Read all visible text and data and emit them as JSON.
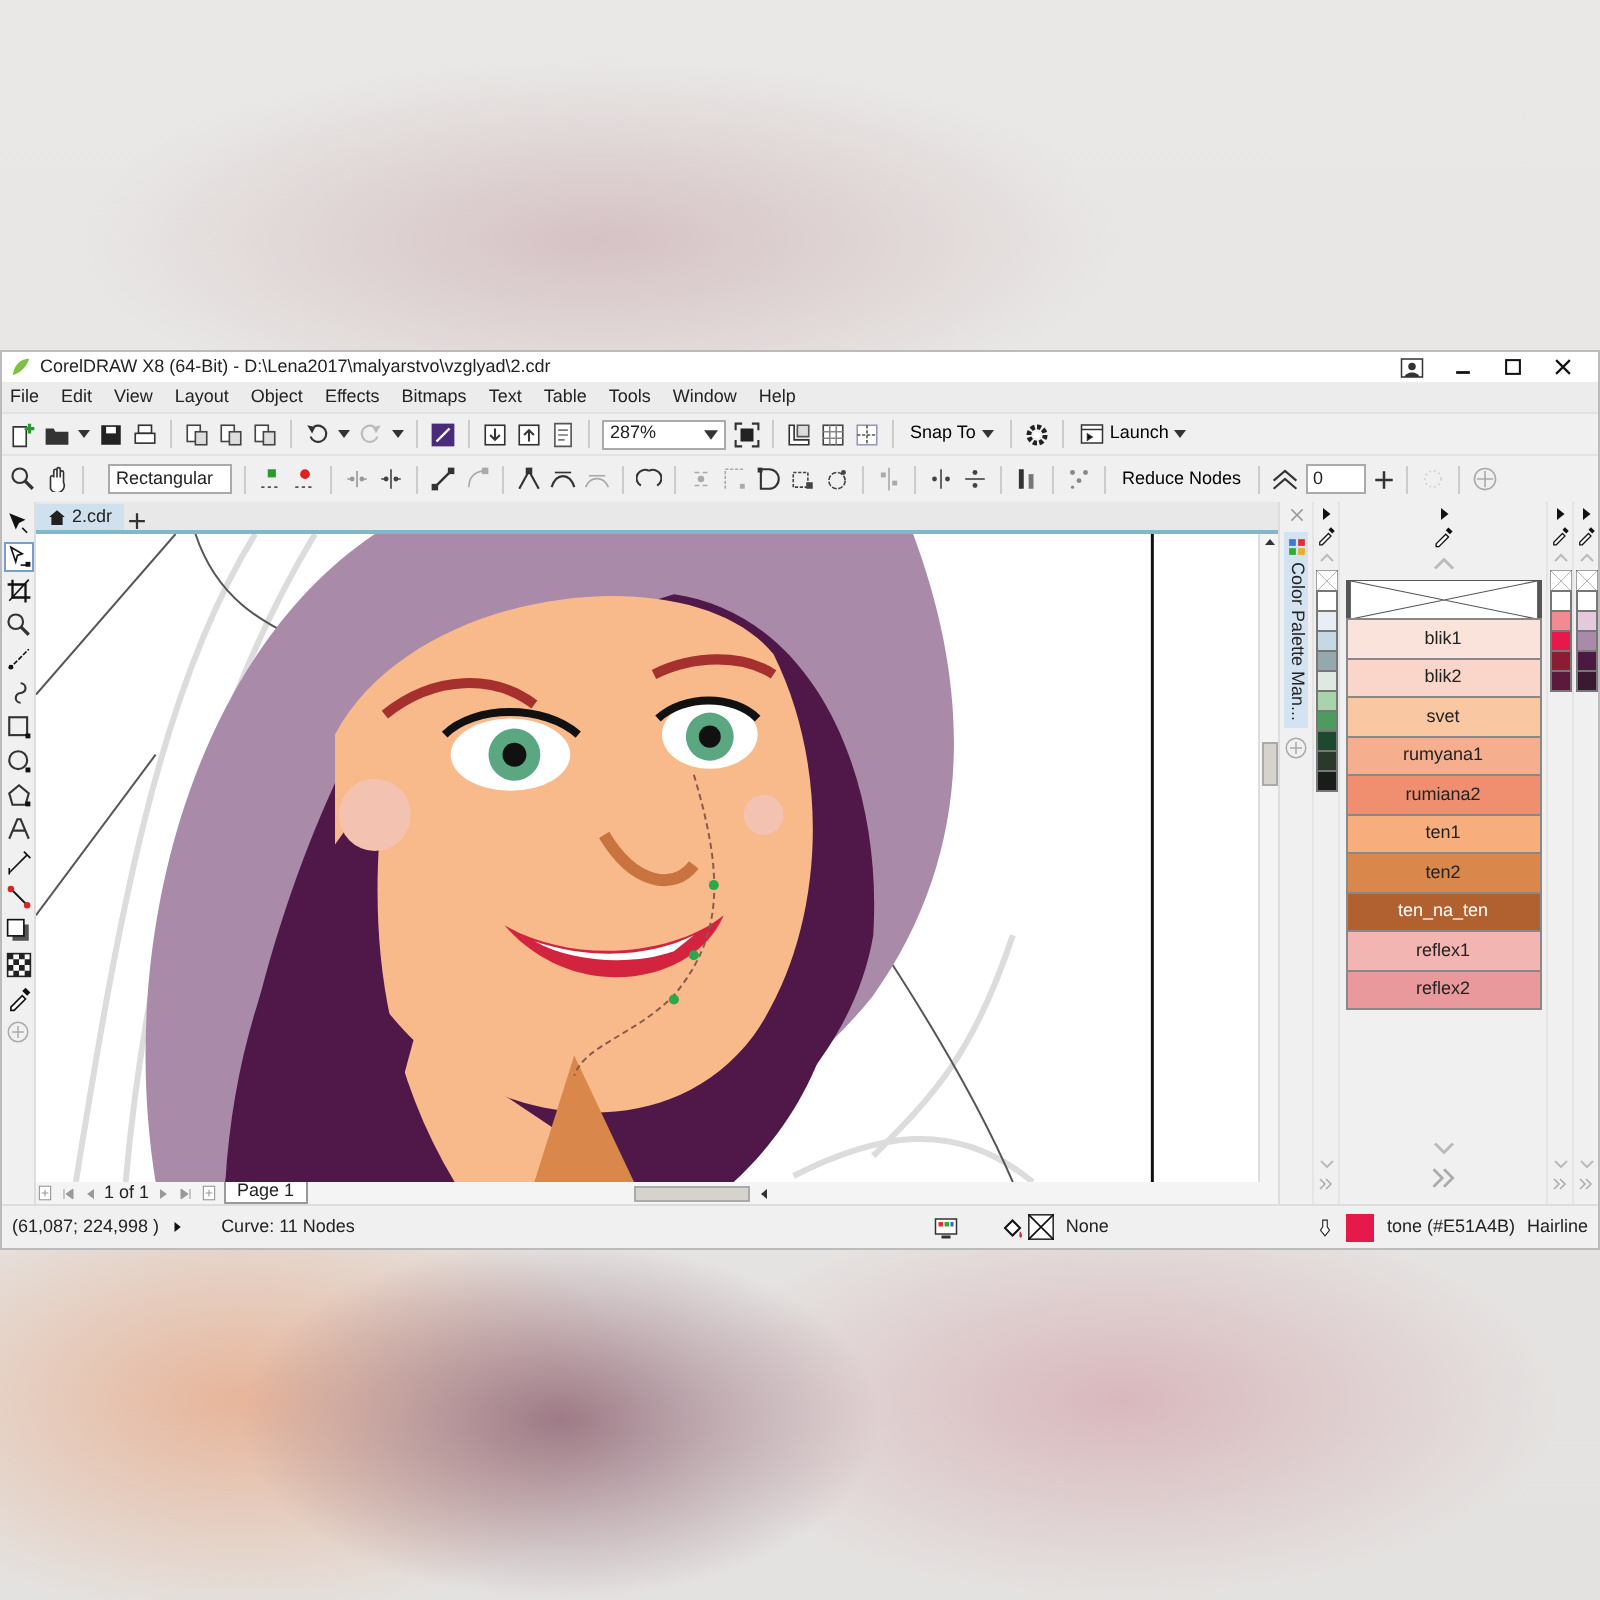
{
  "window": {
    "title": "CorelDRAW X8 (64-Bit) - D:\\Lena2017\\malyarstvo\\vzglyad\\2.cdr"
  },
  "menu": [
    "File",
    "Edit",
    "View",
    "Layout",
    "Object",
    "Effects",
    "Bitmaps",
    "Text",
    "Table",
    "Tools",
    "Window",
    "Help"
  ],
  "toolbar": {
    "zoom": "287%",
    "snap_to": "Snap To",
    "launch": "Launch"
  },
  "property_bar": {
    "selection_mode": "Rectangular",
    "reduce_nodes": "Reduce Nodes",
    "smoothness": "0"
  },
  "document_tabs": [
    {
      "label": "2.cdr",
      "selected": true
    }
  ],
  "toolbox": [
    {
      "selected": false
    },
    {
      "selected": true
    },
    {
      "selected": false
    },
    {
      "selected": false
    },
    {
      "selected": false
    },
    {
      "selected": false
    },
    {
      "selected": false
    },
    {
      "selected": false
    },
    {
      "selected": false
    },
    {
      "selected": false
    },
    {
      "selected": false
    },
    {
      "selected": false
    },
    {
      "selected": false
    },
    {
      "selected": false
    },
    {
      "selected": false
    }
  ],
  "page_navigator": {
    "page_count": "1 of 1",
    "pages": [
      {
        "label": "Page 1",
        "selected": true
      }
    ]
  },
  "docker": {
    "title": "Color Palette Man..."
  },
  "palettes": [
    {
      "kind": "strip",
      "swatches": [
        {
          "color": "#ffffff"
        },
        {
          "color": "#e8eef6"
        },
        {
          "color": "#c5d9e4"
        },
        {
          "color": "#94a8ae"
        },
        {
          "color": "#dfe9e1"
        },
        {
          "color": "#a9d3aa"
        },
        {
          "color": "#4f9a5f"
        },
        {
          "color": "#1d4a2e"
        },
        {
          "color": "#2b382c"
        },
        {
          "color": "#1a1c1a"
        }
      ]
    },
    {
      "kind": "named",
      "swatches": [
        {
          "label": "blik1",
          "color": "#fae3da"
        },
        {
          "label": "blik2",
          "color": "#f9d6c9"
        },
        {
          "label": "svet",
          "color": "#f9c8a2"
        },
        {
          "label": "rumyana1",
          "color": "#f5af8e"
        },
        {
          "label": "rumiana2",
          "color": "#f08f70"
        },
        {
          "label": "ten1",
          "color": "#f7ad7c"
        },
        {
          "label": "ten2",
          "color": "#d9874a"
        },
        {
          "label": "ten_na_ten",
          "color": "#b0612f"
        },
        {
          "label": "reflex1",
          "color": "#f3b5b1"
        },
        {
          "label": "reflex2",
          "color": "#e9999b"
        }
      ]
    },
    {
      "kind": "strip",
      "swatches": [
        {
          "color": "#ffffff"
        },
        {
          "color": "#f08b91"
        },
        {
          "color": "#e51a4b"
        },
        {
          "color": "#8c1c33"
        },
        {
          "color": "#5b1a3c"
        }
      ]
    },
    {
      "kind": "strip",
      "swatches": [
        {
          "color": "#ffffff"
        },
        {
          "color": "#e4c9dd"
        },
        {
          "color": "#a98aa9"
        },
        {
          "color": "#4b1a42"
        },
        {
          "color": "#3a1a31"
        }
      ]
    }
  ],
  "status_bar": {
    "coordinates": "(61,087; 224,998 )",
    "object_info": "Curve: 11 Nodes",
    "fill": "None",
    "outline_swatch": {
      "color": "#e51a4b"
    },
    "outline_label": "tone (#E51A4B)",
    "outline_width": "Hairline"
  }
}
